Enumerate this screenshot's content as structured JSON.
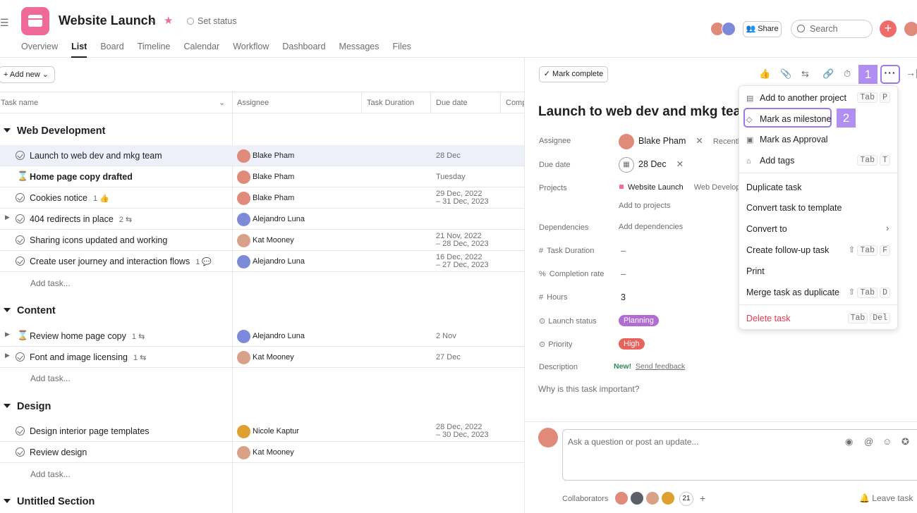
{
  "project": {
    "title": "Website Launch",
    "set_status": "Set status"
  },
  "tabs": [
    "Overview",
    "List",
    "Board",
    "Timeline",
    "Calendar",
    "Workflow",
    "Dashboard",
    "Messages",
    "Files"
  ],
  "header": {
    "share": "Share",
    "search_placeholder": "Search",
    "plus": "+"
  },
  "list": {
    "add_new": "+ Add new",
    "columns": [
      "Task name",
      "Assignee",
      "Task Duration",
      "Due date",
      "Comp"
    ],
    "add_task": "Add task..."
  },
  "sections": [
    {
      "name": "Web Development",
      "tasks": [
        {
          "name": "Launch to web dev and mkg team",
          "assignee": "Blake Pham",
          "due": "28 Dec",
          "due2": "",
          "meta": ""
        },
        {
          "name": "Home page copy drafted",
          "assignee": "Blake Pham",
          "due": "Tuesday",
          "due2": "",
          "meta": ""
        },
        {
          "name": "Cookies notice",
          "assignee": "Blake Pham",
          "due": "29 Dec, 2022",
          "due2": "– 31 Dec, 2023",
          "meta": "1 👍"
        },
        {
          "name": "404 redirects in place",
          "assignee": "Alejandro Luna",
          "due": "",
          "due2": "",
          "meta": "2 ⇆"
        },
        {
          "name": "Sharing icons updated and working",
          "assignee": "Kat Mooney",
          "due": "21 Nov, 2022",
          "due2": "– 28 Dec, 2023",
          "meta": ""
        },
        {
          "name": "Create user journey and interaction flows",
          "assignee": "Alejandro Luna",
          "due": "16 Dec, 2022",
          "due2": "– 27 Dec, 2023",
          "meta": "1 💬"
        }
      ]
    },
    {
      "name": "Content",
      "tasks": [
        {
          "name": "Review home page copy",
          "assignee": "Alejandro Luna",
          "due": "2 Nov",
          "due2": "",
          "meta": "1 ⇆"
        },
        {
          "name": "Font and image licensing",
          "assignee": "Kat Mooney",
          "due": "27 Dec",
          "due2": "",
          "meta": "1 ⇆"
        }
      ]
    },
    {
      "name": "Design",
      "tasks": [
        {
          "name": "Design interior page templates",
          "assignee": "Nicole Kaptur",
          "due": "28 Dec, 2022",
          "due2": "– 30 Dec, 2023",
          "meta": ""
        },
        {
          "name": "Review design",
          "assignee": "Kat Mooney",
          "due": "",
          "due2": "",
          "meta": ""
        }
      ]
    },
    {
      "name": "Untitled Section",
      "tasks": []
    }
  ],
  "detail": {
    "mark_complete": "✓ Mark complete",
    "badge1": "1",
    "badge2": "2",
    "more": "···",
    "title": "Launch to web dev and mkg team",
    "fields": {
      "assignee_label": "Assignee",
      "assignee": "Blake Pham",
      "recently": "Recentl",
      "due_label": "Due date",
      "due": "28 Dec",
      "projects_label": "Projects",
      "project1": "Website Launch",
      "project2": "Web Develop",
      "add_projects": "Add to projects",
      "deps_label": "Dependencies",
      "add_deps": "Add dependencies",
      "duration_label": "Task Duration",
      "duration": "–",
      "completion_label": "Completion rate",
      "completion": "–",
      "hours_label": "Hours",
      "hours": "3",
      "launch_label": "Launch status",
      "launch": "Planning",
      "priority_label": "Priority",
      "priority": "High",
      "desc_label": "Description",
      "new": "New!",
      "feedback": "Send feedback",
      "desc_placeholder": "Why is this task important?"
    },
    "comment_placeholder": "Ask a question or post an update...",
    "collaborators": "Collaborators",
    "collab_count": "21",
    "leave": "Leave task"
  },
  "menu": {
    "add_project": "Add to another project",
    "milestone": "Mark as milestone",
    "approval": "Mark as Approval",
    "tags": "Add tags",
    "duplicate": "Duplicate task",
    "template": "Convert task to template",
    "convert": "Convert to",
    "followup": "Create follow-up task",
    "print": "Print",
    "merge": "Merge task as duplicate",
    "delete": "Delete task"
  },
  "colors": {
    "accent": "#9b7ae8",
    "pink": "#f06a99",
    "planning": "#b36bd4",
    "high": "#e8635c"
  }
}
